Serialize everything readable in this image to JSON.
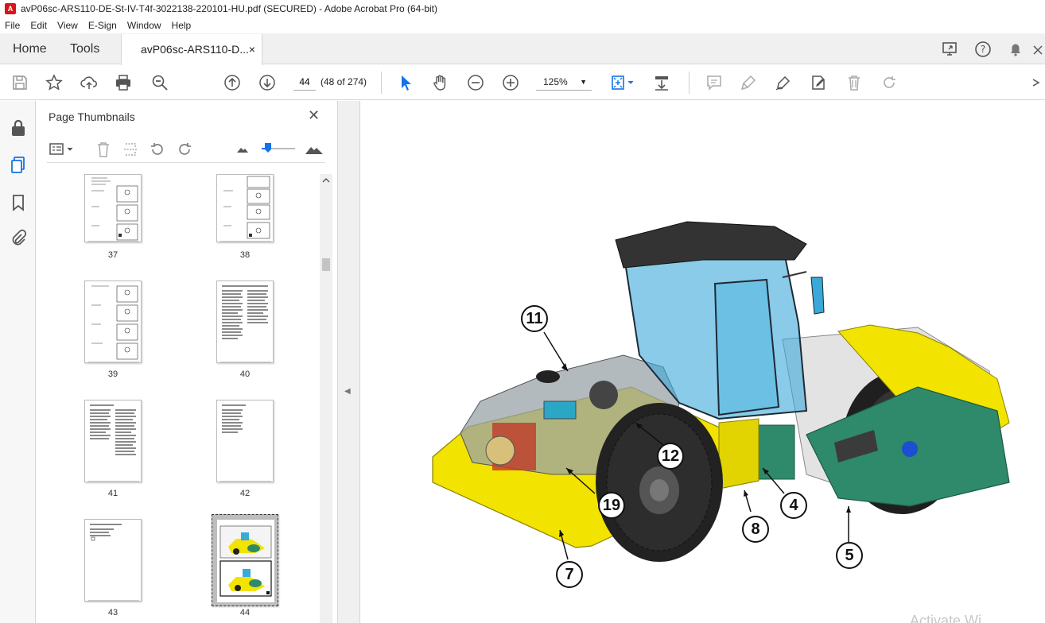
{
  "window": {
    "title": "avP06sc-ARS110-DE-St-IV-T4f-3022138-220101-HU.pdf (SECURED) - Adobe Acrobat Pro (64-bit)"
  },
  "menu": [
    "File",
    "Edit",
    "View",
    "E-Sign",
    "Window",
    "Help"
  ],
  "tabs": {
    "home": "Home",
    "tools": "Tools",
    "document": "avP06sc-ARS110-D...",
    "close": "×"
  },
  "toolbar": {
    "page_value": "44",
    "page_of": "(48 of 274)",
    "zoom": "125%"
  },
  "thumbnails": {
    "title": "Page Thumbnails",
    "close": "✕",
    "pages": [
      "37",
      "38",
      "39",
      "40",
      "41",
      "42",
      "43",
      "44"
    ],
    "selected": "44"
  },
  "document": {
    "callouts": [
      "11",
      "12",
      "19",
      "4",
      "8",
      "5",
      "7"
    ],
    "watermark": "Activate Wi"
  },
  "colors": {
    "accent": "#1473e6",
    "machine_yellow": "#f2e300",
    "drum_green": "#2e8a6a",
    "cab_blue": "#3aa8d8",
    "pdf_red": "#d7141a"
  }
}
